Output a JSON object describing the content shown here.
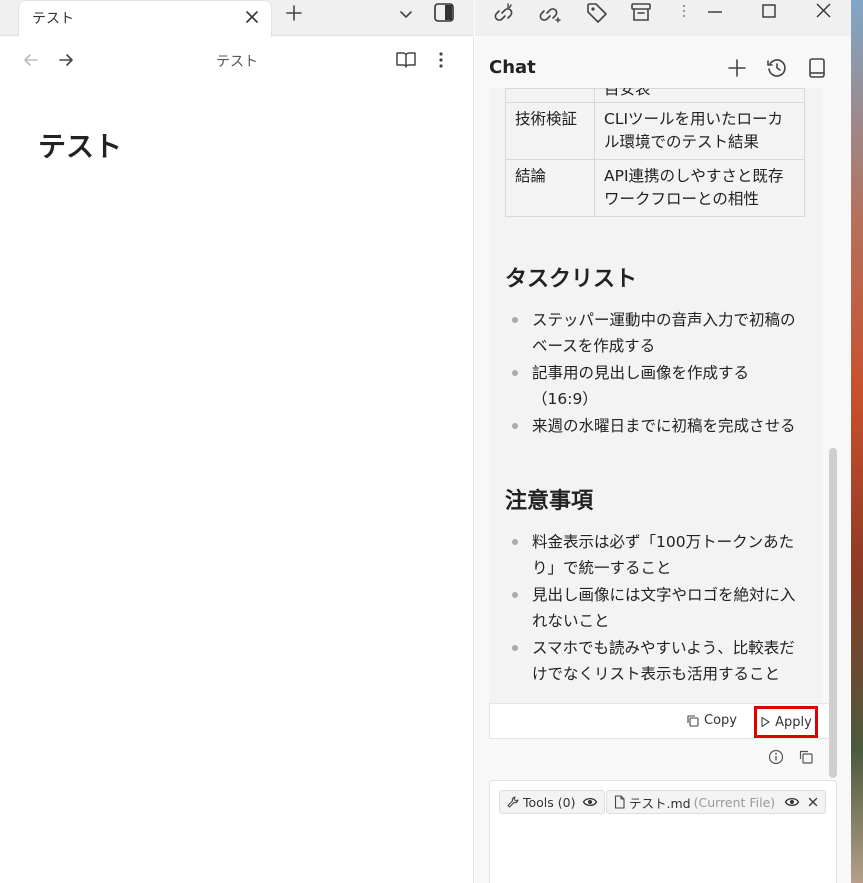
{
  "colors": {
    "highlight": "#e00000",
    "bullet": "#aaaaaa"
  },
  "left": {
    "tab_title": "テスト",
    "view_title": "テスト",
    "heading": "テスト",
    "icons": [
      "close-icon",
      "plus-icon",
      "chevron-down-icon",
      "sidebar-toggle-icon",
      "arrow-left-icon",
      "arrow-right-icon",
      "book-open-icon",
      "more-vertical-icon"
    ]
  },
  "topbar": {
    "icons": [
      "link-icon",
      "link-out-icon",
      "tag-icon",
      "archive-icon",
      "more-vertical-icon",
      "minimize-icon",
      "maximize-icon",
      "close-icon"
    ]
  },
  "chat": {
    "title": "Chat",
    "clipped_cell": "目安表",
    "table_rows": [
      {
        "key": "技術検証",
        "value": "CLIツールを用いたローカル環境でのテスト結果"
      },
      {
        "key": "結論",
        "value": "API連携のしやすさと既存ワークフローとの相性"
      }
    ],
    "tasks_heading": "タスクリスト",
    "tasks": [
      "ステッパー運動中の音声入力で初稿のベースを作成する",
      "記事用の見出し画像を作成する（16:9）",
      "来週の水曜日までに初稿を完成させる"
    ],
    "notes_heading": "注意事項",
    "notes": [
      "料金表示は必ず「100万トークンあたり」で統一すること",
      "見出し画像には文字やロゴを絶対に入れないこと",
      "スマホでも読みやすいよう、比較表だけでなくリスト表示も活用すること"
    ],
    "copy_label": "Copy",
    "apply_label": "Apply",
    "input": {
      "tools_label": "Tools (0)",
      "file_label": "テスト.md",
      "file_tag": "(Current File)"
    }
  }
}
